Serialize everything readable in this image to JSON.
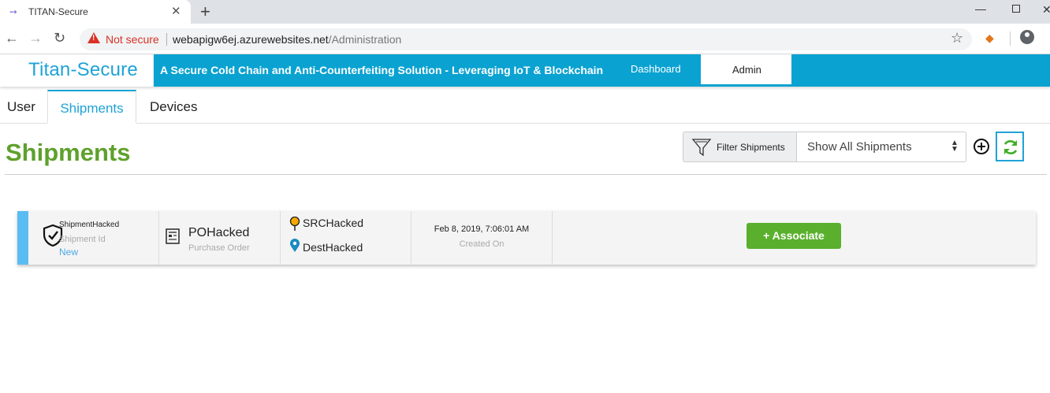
{
  "browser": {
    "tab_title": "TITAN-Secure",
    "tab_close": "✕",
    "new_tab": "+",
    "security_label": "Not secure",
    "url_host": "webapigw6ej.azurewebsites.net",
    "url_path": "/Administration",
    "window_min": "—",
    "window_close": "✕"
  },
  "header": {
    "brand": "Titan-Secure",
    "tagline": "A Secure Cold Chain and Anti-Counterfeiting Solution - Leveraging IoT & Blockchain",
    "nav": [
      {
        "label": "Dashboard",
        "active": false
      },
      {
        "label": "Admin",
        "active": true
      }
    ]
  },
  "tabs": [
    {
      "label": "User",
      "active": false
    },
    {
      "label": "Shipments",
      "active": true
    },
    {
      "label": "Devices",
      "active": false
    }
  ],
  "page": {
    "title": "Shipments",
    "filter_label": "Filter Shipments",
    "filter_selected": "Show All Shipments"
  },
  "shipments": [
    {
      "name": "ShipmentHacked",
      "id_label": "Shipment Id",
      "status": "New",
      "po": "POHacked",
      "po_label": "Purchase Order",
      "source": "SRCHacked",
      "destination": "DestHacked",
      "created": "Feb 8, 2019, 7:06:01 AM",
      "created_label": "Created On",
      "action_label": "+ Associate"
    }
  ],
  "colors": {
    "brand": "#1fa3d6",
    "banner": "#0aa2d1",
    "title_green": "#5ea12c",
    "button_green": "#5ab02c",
    "accent_blue": "#5bbcf2",
    "warning_red": "#d93025"
  },
  "icons": [
    "back-arrow-icon",
    "forward-arrow-icon",
    "reload-icon",
    "warning-icon",
    "star-icon",
    "extension-icon",
    "profile-icon",
    "funnel-icon",
    "add-circle-icon",
    "refresh-icon",
    "shield-icon",
    "document-icon",
    "pin-icon"
  ]
}
